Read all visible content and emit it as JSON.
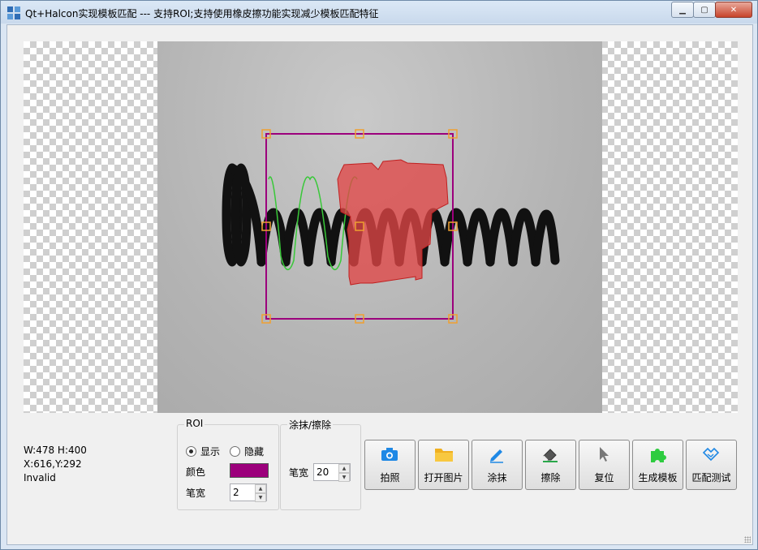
{
  "window": {
    "title": "Qt+Halcon实现模板匹配 --- 支持ROI;支持使用橡皮擦功能实现减少模板匹配特征"
  },
  "status": {
    "size": "W:478 H:400",
    "coords": "X:616,Y:292",
    "state": "Invalid"
  },
  "roi_group": {
    "title": "ROI",
    "show_label": "显示",
    "hide_label": "隐藏",
    "selected": "show",
    "color_label": "颜色",
    "color_value": "#9c007c",
    "pen_label": "笔宽",
    "pen_value": "2"
  },
  "paint_group": {
    "title": "涂抹/擦除",
    "pen_label": "笔宽",
    "pen_value": "20"
  },
  "toolbar": {
    "buttons": [
      {
        "label": "拍照",
        "icon": "camera-icon"
      },
      {
        "label": "打开图片",
        "icon": "folder-icon"
      },
      {
        "label": "涂抹",
        "icon": "pen-icon"
      },
      {
        "label": "擦除",
        "icon": "eraser-icon"
      },
      {
        "label": "复位",
        "icon": "cursor-icon"
      },
      {
        "label": "生成模板",
        "icon": "puzzle-icon"
      },
      {
        "label": "匹配测试",
        "icon": "handshake-icon"
      }
    ]
  },
  "colors": {
    "roi_rect": "#9c007c",
    "handle": "#f0a030",
    "painted_mask": "#e05050",
    "contour": "#38c838"
  }
}
